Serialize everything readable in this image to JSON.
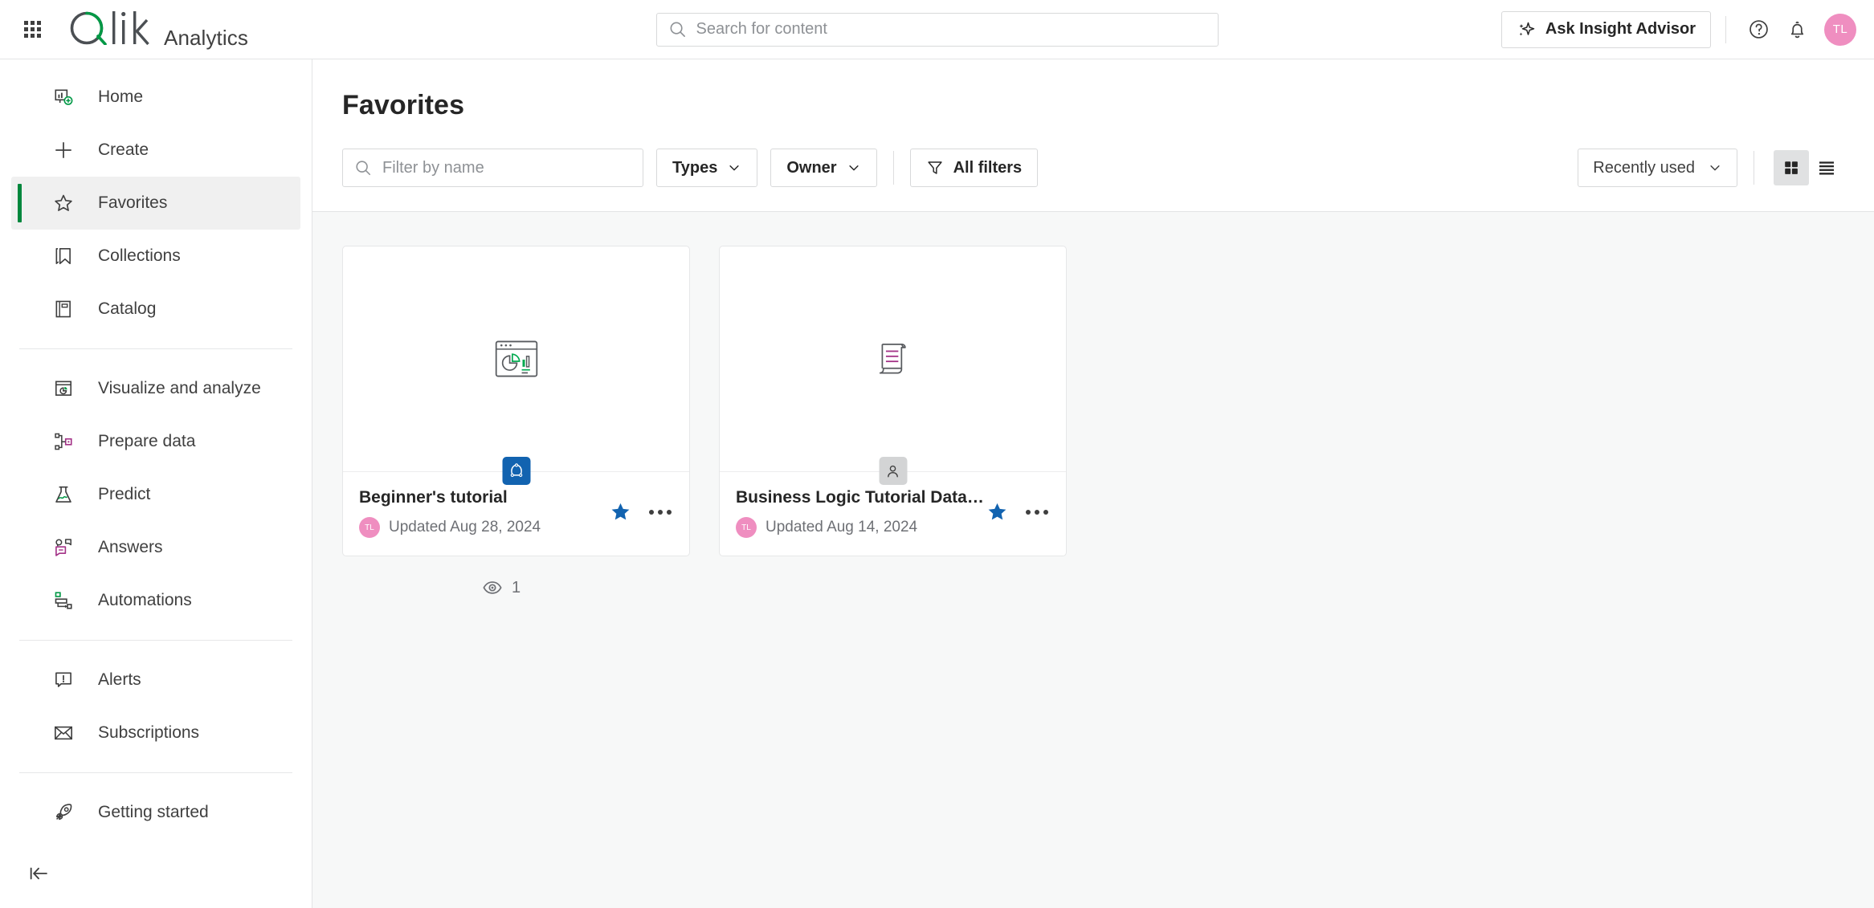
{
  "header": {
    "launcher_label": "app-launcher",
    "brand": "Qlik",
    "product": "Analytics",
    "search": {
      "value": "",
      "placeholder": "Search for content"
    },
    "insight_advisor_label": "Ask Insight Advisor",
    "avatar_initials": "TL",
    "avatar_color": "#ef8ec0"
  },
  "sidebar": {
    "groups": [
      {
        "items": [
          {
            "label": "Home",
            "icon": "home-chart-icon",
            "active": false
          },
          {
            "label": "Create",
            "icon": "plus-icon",
            "active": false
          },
          {
            "label": "Favorites",
            "icon": "star-outline-icon",
            "active": true
          },
          {
            "label": "Collections",
            "icon": "bookmark-icon",
            "active": false
          },
          {
            "label": "Catalog",
            "icon": "catalog-book-icon",
            "active": false
          }
        ]
      },
      {
        "items": [
          {
            "label": "Visualize and analyze",
            "icon": "visualize-icon",
            "active": false
          },
          {
            "label": "Prepare data",
            "icon": "prepare-data-icon",
            "active": false
          },
          {
            "label": "Predict",
            "icon": "flask-icon",
            "active": false
          },
          {
            "label": "Answers",
            "icon": "answers-chat-icon",
            "active": false
          },
          {
            "label": "Automations",
            "icon": "automations-icon",
            "active": false
          }
        ]
      },
      {
        "items": [
          {
            "label": "Alerts",
            "icon": "alert-bubble-icon",
            "active": false
          },
          {
            "label": "Subscriptions",
            "icon": "envelope-icon",
            "active": false
          }
        ]
      },
      {
        "items": [
          {
            "label": "Getting started",
            "icon": "rocket-icon",
            "active": false
          }
        ]
      }
    ],
    "collapse_icon": "collapse-left-icon",
    "active_indicator_color": "#00873d"
  },
  "main": {
    "page_title": "Favorites",
    "toolbar": {
      "filter_input": {
        "value": "",
        "placeholder": "Filter by name"
      },
      "types_label": "Types",
      "owner_label": "Owner",
      "all_filters_label": "All filters",
      "sort_label": "Recently used",
      "grid_view_label": "grid-view",
      "list_view_label": "list-view",
      "active_view": "grid"
    },
    "cards": [
      {
        "title": "Beginner's tutorial",
        "updated": "Updated Aug 28, 2024",
        "owner_initials": "TL",
        "owner_color": "#ef8ec0",
        "thumb_icon": "app-chart-thumbnail-icon",
        "badge_icon": "qlik-app-badge-icon",
        "badge_color": "#1263b0",
        "badge_style": "blue",
        "favorited": true,
        "star_color": "#1263b0"
      },
      {
        "title": "Business Logic Tutorial Data Prep",
        "updated": "Updated Aug 14, 2024",
        "owner_initials": "TL",
        "owner_color": "#ef8ec0",
        "thumb_icon": "script-scroll-thumbnail-icon",
        "badge_icon": "person-badge-icon",
        "badge_color": "#d3d4d5",
        "badge_style": "gray",
        "favorited": true,
        "star_color": "#1263b0"
      }
    ],
    "view_count": {
      "icon": "eye-icon",
      "value": "1"
    }
  },
  "colors": {
    "qlik_green": "#00873d",
    "accent_blue": "#1263b0",
    "purple": "#a33287",
    "text_dark": "#262626",
    "text_muted": "#6e7075",
    "content_bg": "#f7f8f8"
  }
}
